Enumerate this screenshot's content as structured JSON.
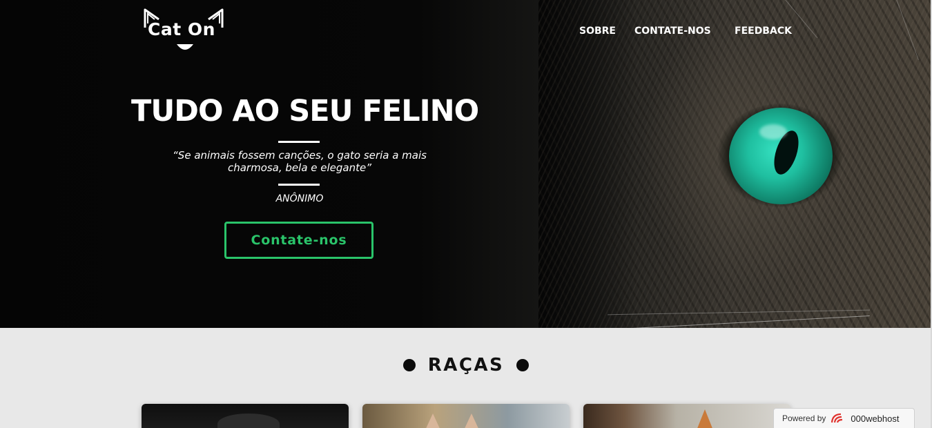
{
  "logo": {
    "text": "Cat On"
  },
  "nav": {
    "items": [
      {
        "label": "SOBRE"
      },
      {
        "label": "CONTATE-NOS"
      },
      {
        "label": "FEEDBACK"
      }
    ]
  },
  "hero": {
    "title": "TUDO AO SEU FELINO",
    "quote": "“Se animais fossem canções, o gato seria a mais charmosa, bela e elegante”",
    "author": "ANÔNIMO",
    "cta_label": "Contate-nos",
    "accent_color": "#2ac46a",
    "eye_color": "#1fbfa0"
  },
  "section": {
    "title": "RAÇAS"
  },
  "badge": {
    "prefix": "Powered by",
    "brand": "000webhost"
  }
}
